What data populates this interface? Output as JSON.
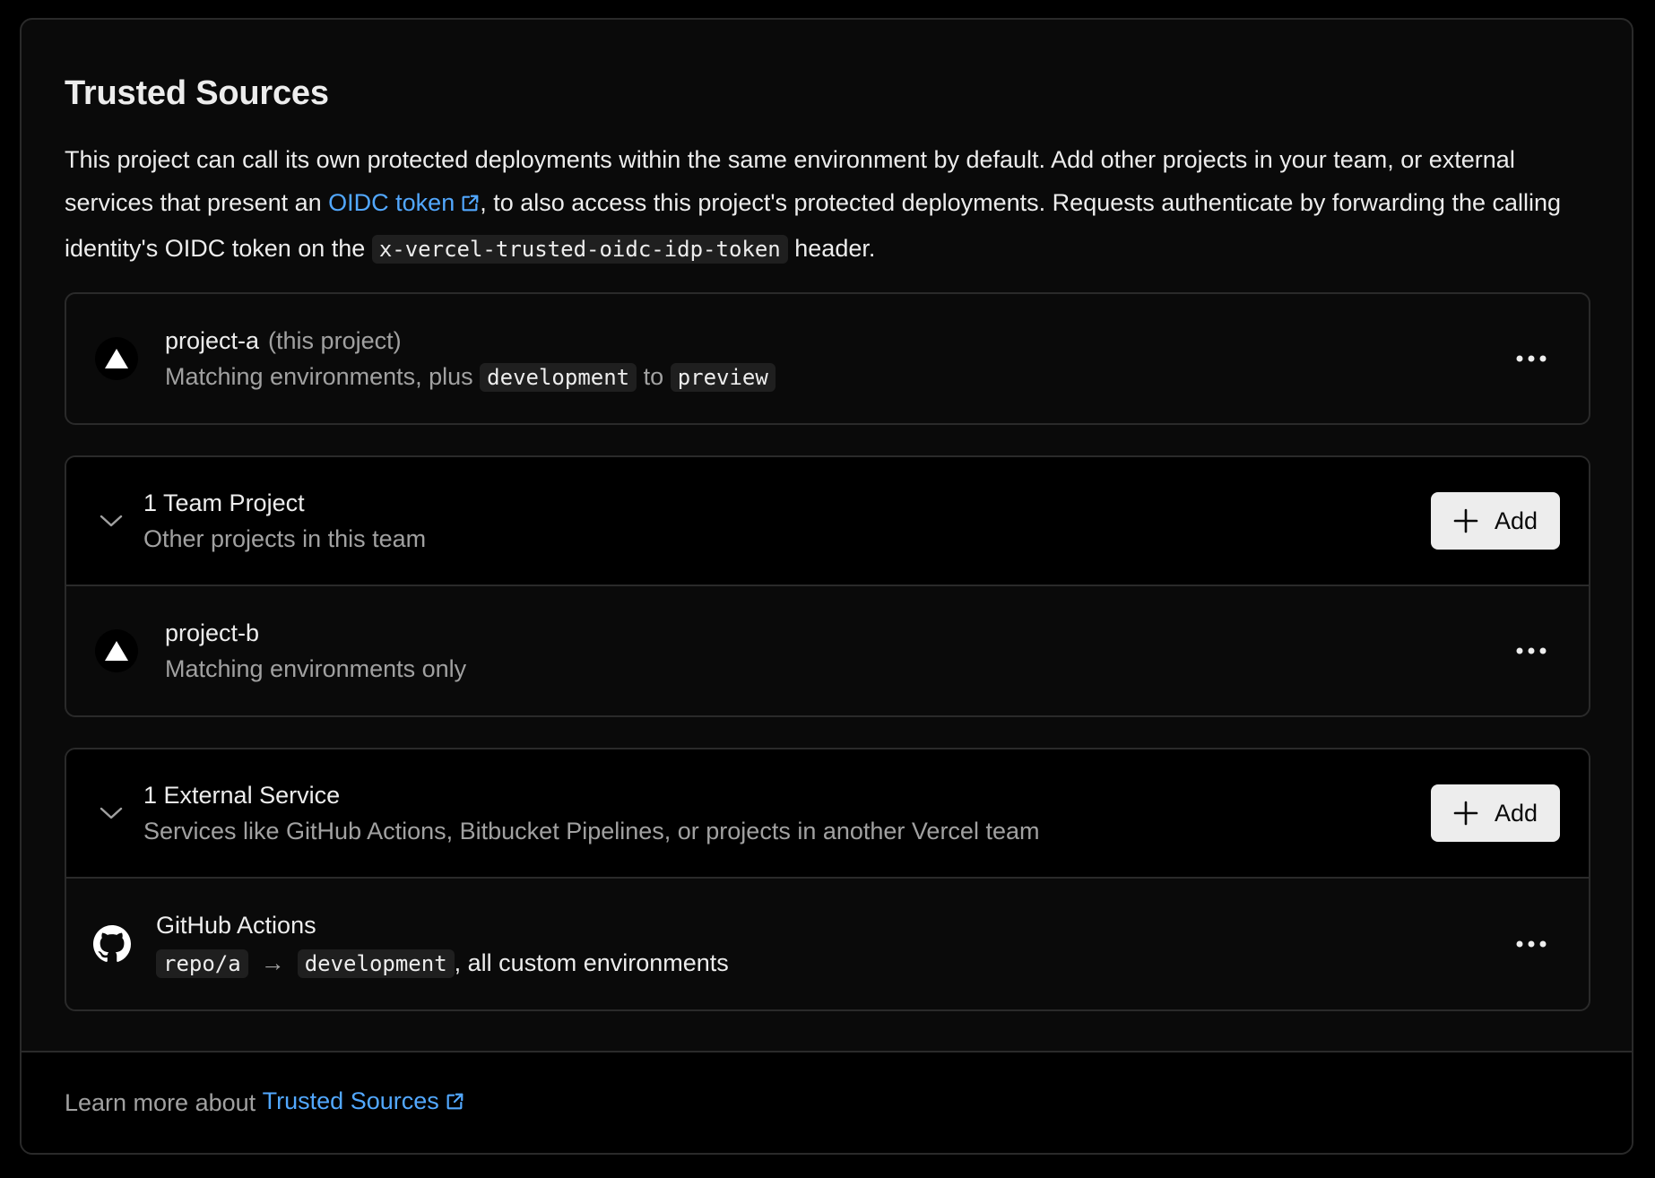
{
  "section": {
    "title": "Trusted Sources",
    "description": {
      "part1": "This project can call its own protected deployments within the same environment by default. Add other projects in your team, or external services that present an ",
      "oidc_link": "OIDC token",
      "part2": ", to also access this project's protected deployments. Requests authenticate by forwarding the calling identity's OIDC token on the ",
      "header_code": "x-vercel-trusted-oidc-idp-token",
      "part3": " header."
    }
  },
  "self_project": {
    "name": "project-a",
    "tag": "(this project)",
    "sub_prefix": "Matching environments, plus ",
    "from_env": "development",
    "connector": "to",
    "to_env": "preview"
  },
  "team_group": {
    "title": "1 Team Project",
    "subtitle": "Other projects in this team",
    "add_label": "Add",
    "items": [
      {
        "name": "project-b",
        "sub": "Matching environments only"
      }
    ]
  },
  "external_group": {
    "title": "1 External Service",
    "subtitle": "Services like GitHub Actions, Bitbucket Pipelines, or projects in another Vercel team",
    "add_label": "Add",
    "items": [
      {
        "name": "GitHub Actions",
        "repo": "repo/a",
        "arrow": "→",
        "env": "development",
        "suffix": ", all custom environments",
        "icon": "github-icon"
      }
    ]
  },
  "footer": {
    "prefix": "Learn more about ",
    "link": "Trusted Sources"
  },
  "colors": {
    "background": "#000000",
    "card": "#0a0a0a",
    "border": "#2a2a2a",
    "link": "#52a8ff",
    "muted_text": "#a1a1a1",
    "button_bg": "#ededed"
  }
}
